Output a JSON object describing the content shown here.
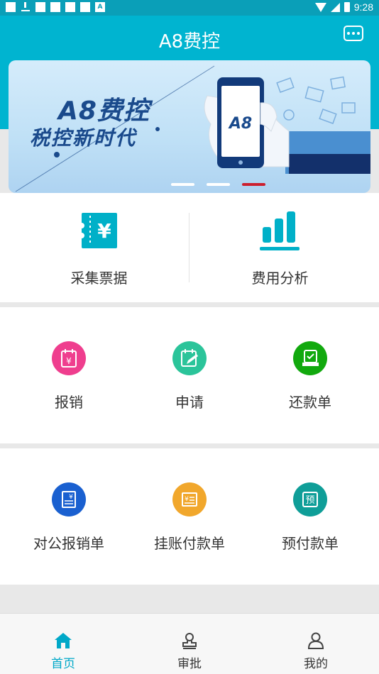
{
  "status_bar": {
    "time": "9:28"
  },
  "header": {
    "title": "A8费控"
  },
  "banner": {
    "slogan_line1": "A8费控",
    "slogan_line2": "税控新时代",
    "phone_logo": "A8",
    "active_slide": 3,
    "slide_count": 3
  },
  "quick_actions": [
    {
      "label": "采集票据",
      "icon": "ticket-yen-icon"
    },
    {
      "label": "费用分析",
      "icon": "bar-chart-icon"
    }
  ],
  "grid1": [
    {
      "label": "报销",
      "icon": "reimbursement-icon",
      "color": "#ef3e8e"
    },
    {
      "label": "申请",
      "icon": "application-icon",
      "color": "#2bc49a"
    },
    {
      "label": "还款单",
      "icon": "repayment-icon",
      "color": "#12a90e"
    }
  ],
  "grid2": [
    {
      "label": "对公报销单",
      "icon": "corporate-reimbursement-icon",
      "color": "#1a60d0"
    },
    {
      "label": "挂账付款单",
      "icon": "payable-payment-icon",
      "color": "#f1a72c"
    },
    {
      "label": "预付款单",
      "icon": "prepayment-icon",
      "color": "#0f9e98"
    }
  ],
  "tabs": [
    {
      "label": "首页",
      "icon": "home-icon",
      "active": true
    },
    {
      "label": "审批",
      "icon": "approval-stamp-icon",
      "active": false
    },
    {
      "label": "我的",
      "icon": "profile-icon",
      "active": false
    }
  ],
  "colors": {
    "primary": "#00b4d0",
    "active_tab": "#00a8c8",
    "banner_text": "#1a4a8c",
    "indicator_active": "#cc1f2e"
  }
}
